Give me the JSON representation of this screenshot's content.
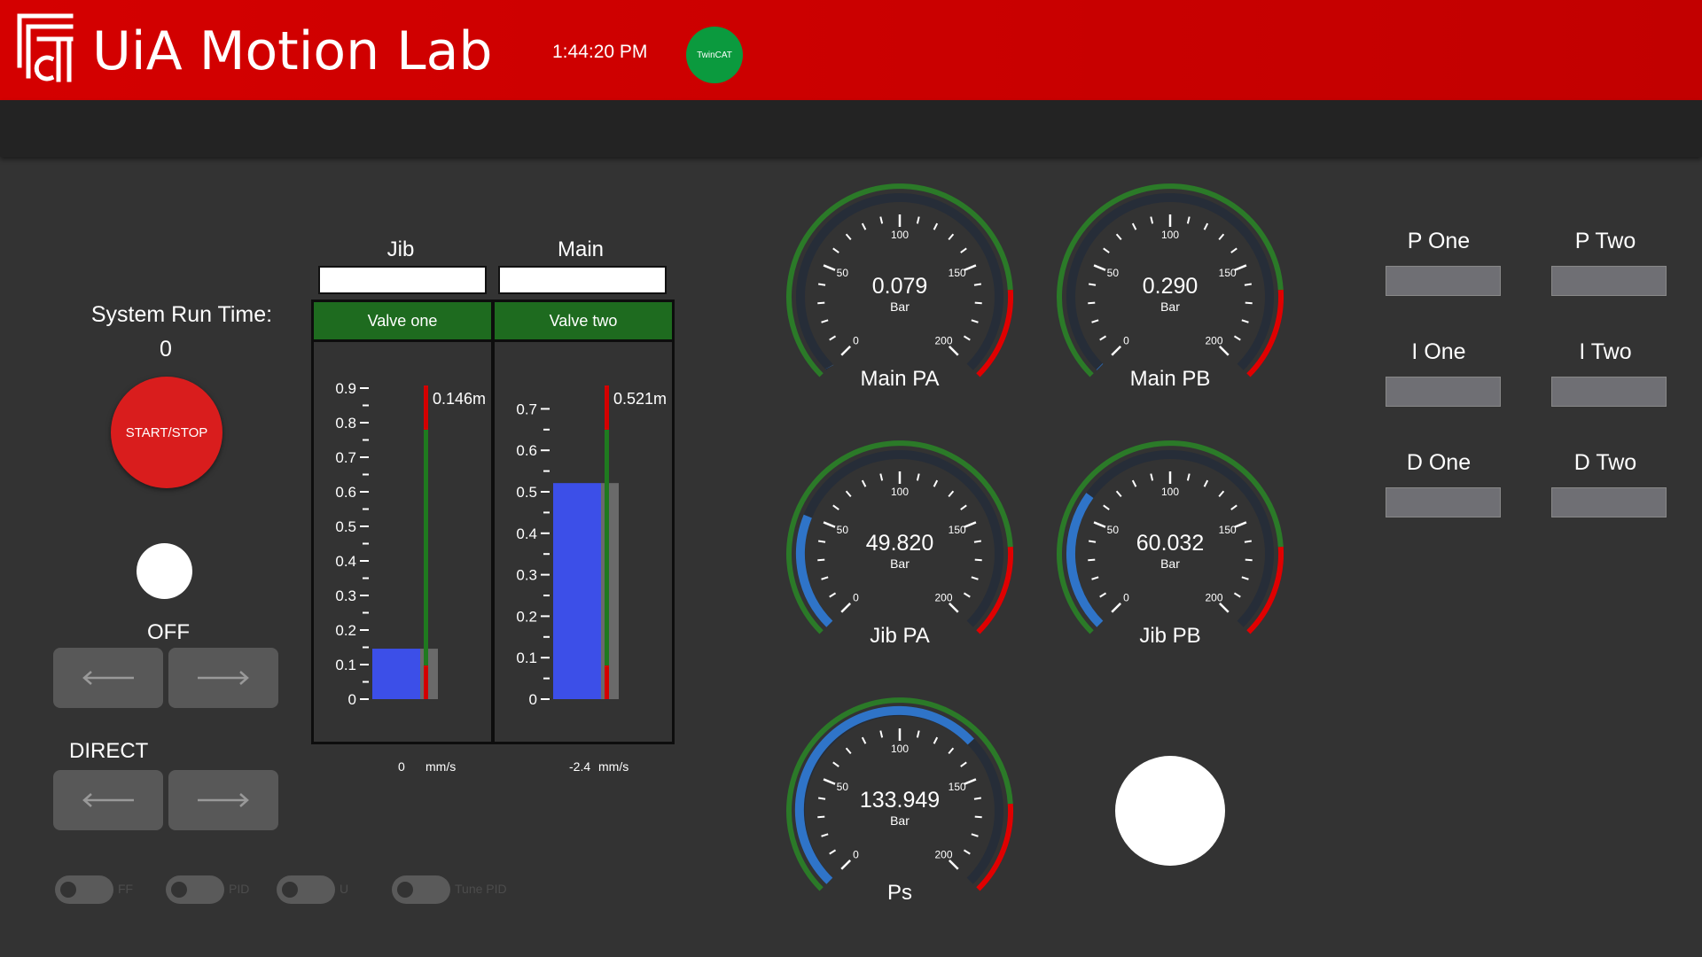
{
  "header": {
    "app_title": "UiA Motion Lab",
    "clock": "1:44:20 PM",
    "twincat_badge": "TwinCAT",
    "logo_icon": "uia-logo-icon"
  },
  "colors": {
    "header_red": "#d40000",
    "background": "#333333",
    "valve_green": "#1e6b1f",
    "gauge_green": "#2b8a2b",
    "gauge_red": "#e00000",
    "gauge_blue": "#2f74c8",
    "bar_blue": "#3c4fe8"
  },
  "control": {
    "runtime_label": "System Run Time:",
    "runtime_value": "0",
    "start_stop_label": "START/STOP",
    "off_label": "OFF",
    "direct_label": "DIRECT",
    "toggles": [
      {
        "label": "FF",
        "on": false
      },
      {
        "label": "PID",
        "on": false
      },
      {
        "label": "U",
        "on": false
      },
      {
        "label": "Tune PID",
        "on": false
      }
    ]
  },
  "valves": {
    "jib": {
      "title": "Jib",
      "valve_label": "Valve one",
      "setpoint_value": "",
      "position_label": "0.146m",
      "position": 0.146,
      "reference": 0.146,
      "scale": [
        0,
        0.9
      ],
      "ticks": [
        "0",
        "0.1",
        "0.2",
        "0.3",
        "0.4",
        "0.5",
        "0.6",
        "0.7",
        "0.8",
        "0.9"
      ],
      "speed_value": "0",
      "speed_unit": "mm/s"
    },
    "main": {
      "title": "Main",
      "valve_label": "Valve two",
      "setpoint_value": "",
      "position_label": "0.521m",
      "position": 0.521,
      "reference": 0.521,
      "scale": [
        0,
        0.75
      ],
      "ticks": [
        "0",
        "0.1",
        "0.2",
        "0.3",
        "0.4",
        "0.5",
        "0.6",
        "0.7"
      ],
      "speed_value": "-2.4",
      "speed_unit": "mm/s"
    }
  },
  "gauges": {
    "unit": "Bar",
    "scale_labels": [
      "0",
      "50",
      "100",
      "150",
      "200"
    ],
    "max": 200,
    "items": [
      {
        "label": "Main PA",
        "value": 0.079,
        "display": "0.079"
      },
      {
        "label": "Main PB",
        "value": 0.29,
        "display": "0.290"
      },
      {
        "label": "Jib PA",
        "value": 49.82,
        "display": "49.820"
      },
      {
        "label": "Jib PB",
        "value": 60.032,
        "display": "60.032"
      },
      {
        "label": "Ps",
        "value": 133.949,
        "display": "133.949"
      }
    ]
  },
  "pid": {
    "p_one": "P One",
    "p_two": "P Two",
    "i_one": "I One",
    "i_two": "I Two",
    "d_one": "D One",
    "d_two": "D Two"
  }
}
